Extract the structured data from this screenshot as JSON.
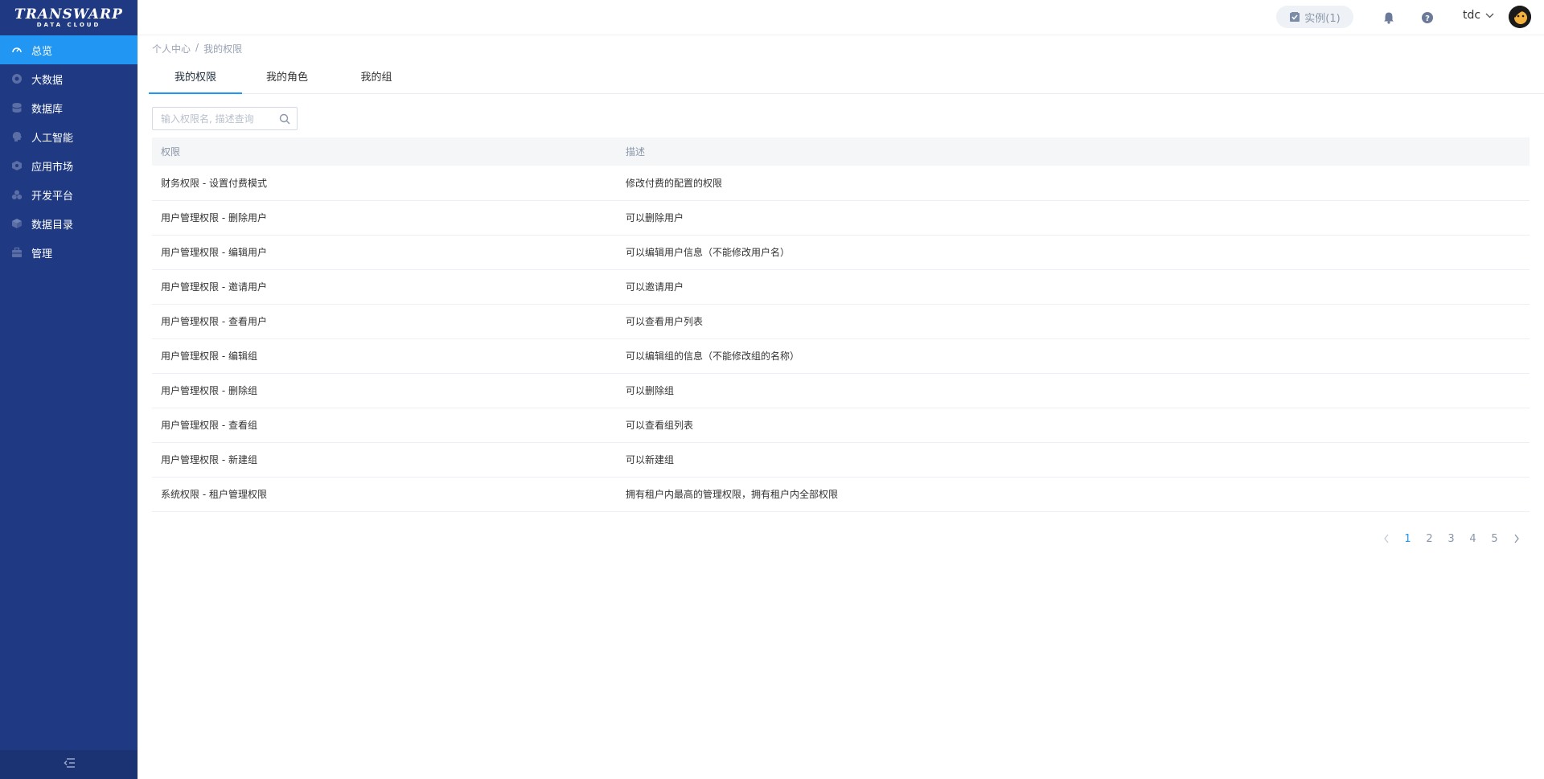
{
  "brand": {
    "name": "TRANSWARP",
    "sub": "DATA CLOUD"
  },
  "sidebar": {
    "items": [
      {
        "label": "总览",
        "icon": "dashboard-icon",
        "active": true
      },
      {
        "label": "大数据",
        "icon": "bigdata-icon"
      },
      {
        "label": "数据库",
        "icon": "database-icon"
      },
      {
        "label": "人工智能",
        "icon": "ai-brain-icon"
      },
      {
        "label": "应用市场",
        "icon": "app-market-icon"
      },
      {
        "label": "开发平台",
        "icon": "dev-platform-icon"
      },
      {
        "label": "数据目录",
        "icon": "data-catalog-icon"
      },
      {
        "label": "管理",
        "icon": "management-icon"
      }
    ],
    "collapse_icon": "collapse-menu-icon"
  },
  "header": {
    "instance_label": "实例(1)",
    "user_name": "tdc"
  },
  "breadcrumb": {
    "parent": "个人中心",
    "separator": "/",
    "current": "我的权限"
  },
  "tabs": [
    {
      "label": "我的权限",
      "active": true
    },
    {
      "label": "我的角色"
    },
    {
      "label": "我的组"
    }
  ],
  "search": {
    "placeholder": "输入权限名, 描述查询",
    "value": ""
  },
  "table": {
    "columns": [
      "权限",
      "描述"
    ],
    "rows": [
      [
        "财务权限 - 设置付费模式",
        "修改付费的配置的权限"
      ],
      [
        "用户管理权限 - 删除用户",
        "可以删除用户"
      ],
      [
        "用户管理权限 - 编辑用户",
        "可以编辑用户信息（不能修改用户名）"
      ],
      [
        "用户管理权限 - 邀请用户",
        "可以邀请用户"
      ],
      [
        "用户管理权限 - 查看用户",
        "可以查看用户列表"
      ],
      [
        "用户管理权限 - 编辑组",
        "可以编辑组的信息（不能修改组的名称）"
      ],
      [
        "用户管理权限 - 删除组",
        "可以删除组"
      ],
      [
        "用户管理权限 - 查看组",
        "可以查看组列表"
      ],
      [
        "用户管理权限 - 新建组",
        "可以新建组"
      ],
      [
        "系统权限 - 租户管理权限",
        "拥有租户内最高的管理权限，拥有租户内全部权限"
      ]
    ]
  },
  "pagination": {
    "pages": [
      "1",
      "2",
      "3",
      "4",
      "5"
    ],
    "current": "1"
  },
  "colors": {
    "sidebar": "#1f3a82",
    "accent": "#2196f3"
  }
}
